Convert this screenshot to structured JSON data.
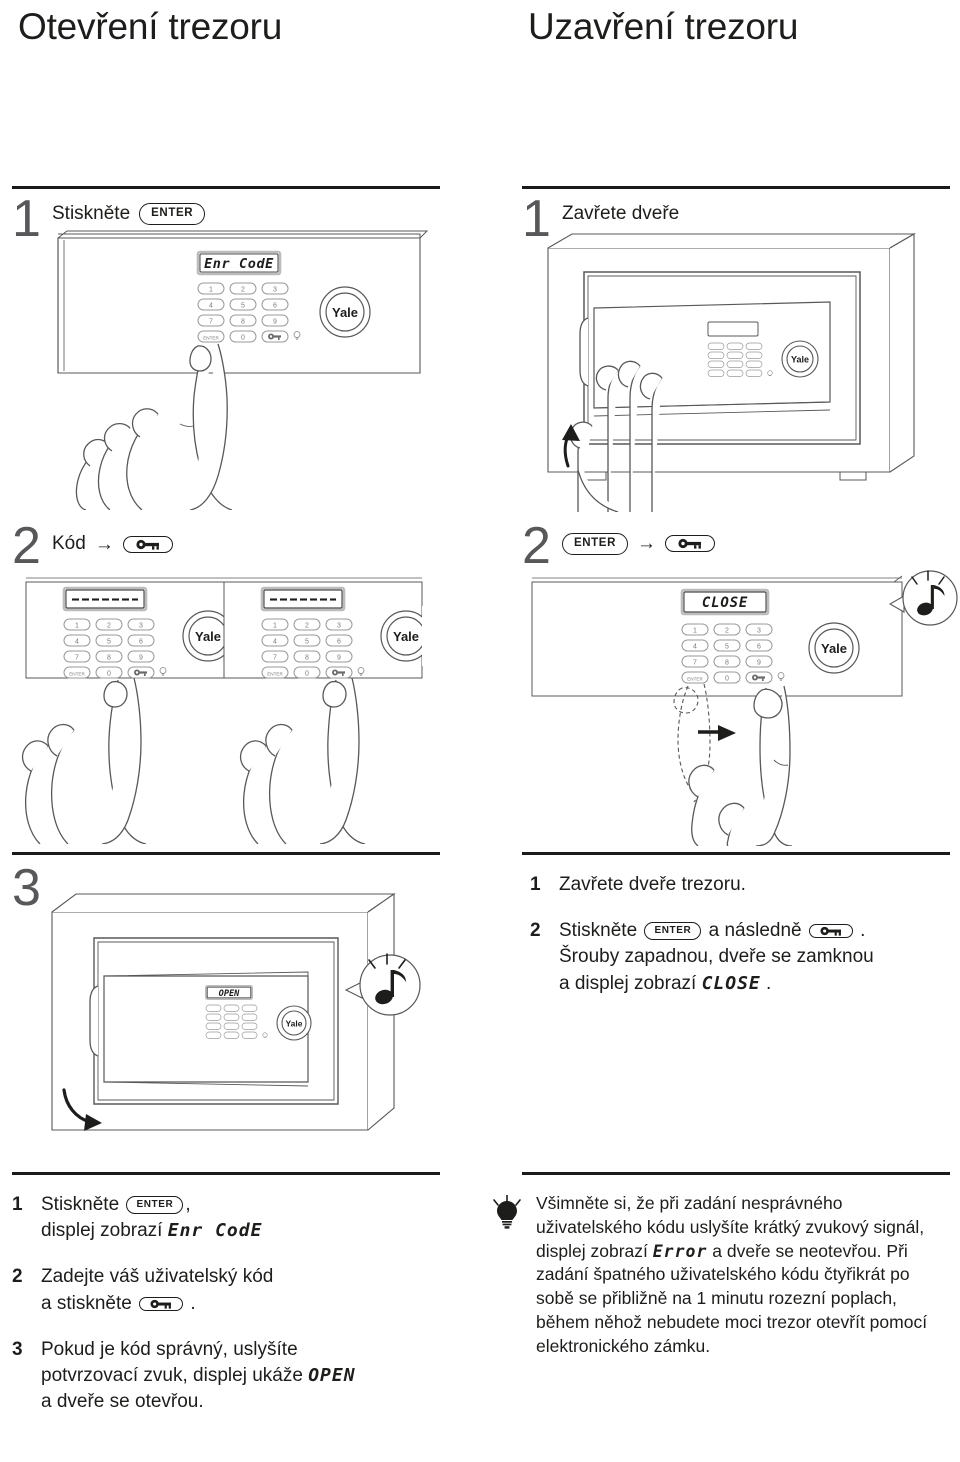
{
  "titles": {
    "left": "Otevření trezoru",
    "right": "Uzavření trezoru"
  },
  "left_column": {
    "step1": {
      "number": "1",
      "label": "Stiskněte",
      "key": "ENTER",
      "display": "Enr CodE"
    },
    "step2": {
      "number": "2",
      "label": "Kód",
      "arrow": "→",
      "key_icon": "key-icon",
      "display": "- - - - - - - -"
    },
    "step3": {
      "number": "3",
      "display": "OPEN",
      "sound": "music-note"
    }
  },
  "right_column": {
    "step1": {
      "number": "1",
      "label": "Zavřete dveře",
      "display": ""
    },
    "step2": {
      "number": "2",
      "key_enter": "ENTER",
      "arrow": "→",
      "key_icon": "key-icon",
      "display": "CLOSE",
      "sound": "music-note"
    }
  },
  "instructions_left": [
    {
      "num": "1",
      "parts": [
        {
          "type": "text",
          "value": "Stiskněte "
        },
        {
          "type": "key",
          "value": "ENTER"
        },
        {
          "type": "text",
          "value": ","
        },
        {
          "type": "break"
        },
        {
          "type": "text",
          "value": "displej zobrazí "
        },
        {
          "type": "lcd",
          "value": "Enr CodE"
        }
      ]
    },
    {
      "num": "2",
      "parts": [
        {
          "type": "text",
          "value": "Zadejte váš uživatelský kód"
        },
        {
          "type": "break"
        },
        {
          "type": "text",
          "value": "a stiskněte "
        },
        {
          "type": "keyicon",
          "value": "key-icon"
        },
        {
          "type": "text",
          "value": " ."
        }
      ]
    },
    {
      "num": "3",
      "parts": [
        {
          "type": "text",
          "value": "Pokud je kód správný, uslyšíte"
        },
        {
          "type": "break"
        },
        {
          "type": "text",
          "value": "potvrzovací zvuk, displej ukáže "
        },
        {
          "type": "lcd",
          "value": "OPEN"
        },
        {
          "type": "break"
        },
        {
          "type": "text",
          "value": "a dveře se otevřou."
        }
      ]
    }
  ],
  "instructions_right": [
    {
      "num": "1",
      "parts": [
        {
          "type": "text",
          "value": "Zavřete dveře trezoru."
        }
      ]
    },
    {
      "num": "2",
      "parts": [
        {
          "type": "text",
          "value": "Stiskněte "
        },
        {
          "type": "key",
          "value": "ENTER"
        },
        {
          "type": "text",
          "value": " a následně "
        },
        {
          "type": "keyicon",
          "value": "key-icon"
        },
        {
          "type": "text",
          "value": " ."
        },
        {
          "type": "break"
        },
        {
          "type": "text",
          "value": "Šrouby zapadnou, dveře se zamknou"
        },
        {
          "type": "break"
        },
        {
          "type": "text",
          "value": "a displej zobrazí "
        },
        {
          "type": "lcd",
          "value": "CLOSE"
        },
        {
          "type": "text",
          "value": " ."
        }
      ]
    }
  ],
  "tip": {
    "icon": "lightbulb-icon",
    "parts": [
      {
        "type": "text",
        "value": "Všimněte si, že při zadání nesprávného uživatelského kódu uslyšíte  krátký zvukový signál, displej zobrazí "
      },
      {
        "type": "lcd",
        "value": "Error"
      },
      {
        "type": "text",
        "value": " a dveře se neotevřou. Při zadání špatného uživatelského kódu čtyřikrát po sobě se přibližně na 1 minutu rozezní poplach, během něhož nebudete moci trezor otevřít pomocí elektronického zámku."
      }
    ]
  },
  "keypad": {
    "rows": [
      [
        "1",
        "2",
        "3"
      ],
      [
        "4",
        "5",
        "6"
      ],
      [
        "7",
        "8",
        "9"
      ],
      [
        "ENTER",
        "0",
        "key-icon"
      ]
    ],
    "brand": "Yale",
    "indicator": "bulb-indicator"
  },
  "colors": {
    "ink": "#1d1d1b",
    "line": "#58585a",
    "rule": "#1a1a1a",
    "display_fill": "#ffffff",
    "display_border": "#bcbcbc"
  }
}
